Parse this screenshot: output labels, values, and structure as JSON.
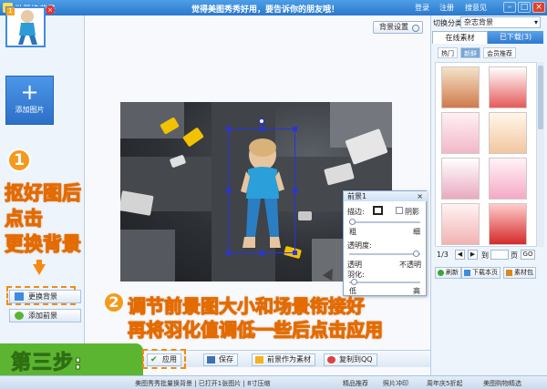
{
  "window": {
    "title": "批量换背景",
    "slogan": "觉得美图秀秀好用，要告诉你的朋友哦！",
    "links": [
      "登录",
      "注册",
      "搜意见"
    ]
  },
  "left_panel": {
    "thumb_number": "1",
    "add_image_label": "添加图片",
    "step1_lines": [
      "抠好图后",
      "点击",
      "更换背景"
    ],
    "replace_bg_label": "更换背景",
    "add_fg_label": "添加前景"
  },
  "canvas": {
    "bg_settings_label": "背景设置"
  },
  "foreground_panel": {
    "title": "前景1",
    "close": "×",
    "stroke_label": "描边:",
    "shadow_label": "阴影",
    "thick_label": "粗",
    "thin_label": "细",
    "opacity_label": "透明度:",
    "transparent_label": "透明",
    "opaque_label": "不透明",
    "feather_label": "羽化:",
    "low_label": "低",
    "high_label": "高"
  },
  "step2": {
    "number": "2",
    "line1": "调节前景图大小和场景衔接好",
    "line2": "再将羽化值调低一些后点击应用"
  },
  "step3_label": "第三步:",
  "action_bar": {
    "apply": "应用",
    "save": "保存",
    "set_fg_material": "前景作为素材",
    "copy_to_qq": "复制到QQ"
  },
  "right_panel": {
    "category_label": "切换分类",
    "category_value": "杂志背景",
    "tabs": [
      "在线素材",
      "已下载(3)"
    ],
    "subtabs": [
      "热门",
      "新鲜",
      "会员推荐"
    ],
    "page": "1/3",
    "goto_label": "到",
    "page_unit": "页",
    "go_label": "GO",
    "refresh": "刷新",
    "download_page": "下载本页",
    "material_pack": "素材包"
  },
  "status_bar": {
    "left": "美图秀秀批量换背景 | 已打开1张图片 | 8寸压缩",
    "items": [
      "精品推荐",
      "照片冲印",
      "周年庆5折起",
      "美图购物精选"
    ]
  },
  "colors": {
    "accent_blue": "#2a78cc",
    "step_orange": "#f58a10",
    "step3_green": "#5cb531",
    "selection_blue": "#2a33e0"
  }
}
